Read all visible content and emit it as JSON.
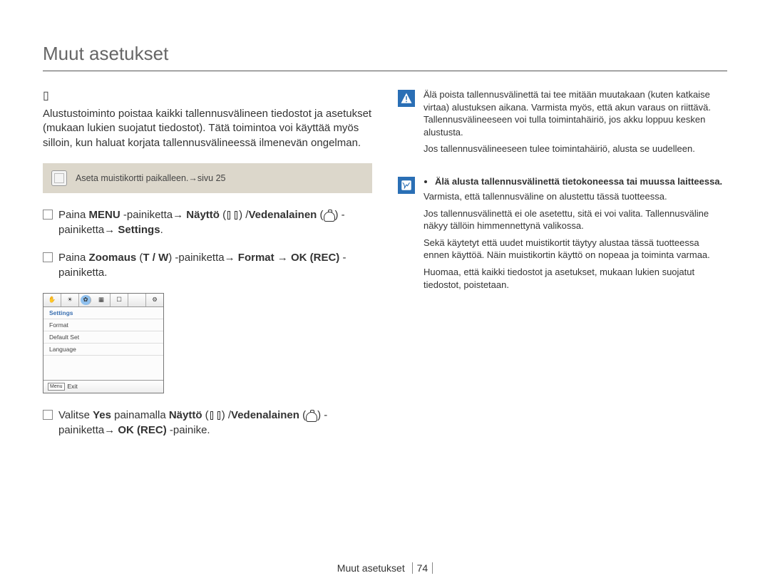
{
  "page": {
    "title": "Muut asetukset",
    "footer_section": "Muut asetukset",
    "page_number": "74"
  },
  "left": {
    "subheading_placeholder": "▯",
    "intro": "Alustustoiminto poistaa kaikki tallennusvälineen tiedostot ja asetukset (mukaan lukien suojatut tiedostot). Tätä toimintoa voi käyttää myös silloin, kun haluat korjata tallennusvälineessä ilmenevän ongelman.",
    "note": "Aseta muistikortti paikalleen.→sivu 25",
    "steps": [
      {
        "t1": "Paina ",
        "b1": "MENU",
        "t2": " -painiketta→ ",
        "b2": "Näyttö",
        "t3": " /",
        "b3": "Vedenalainen",
        "t4": " -painiketta→ ",
        "b4": "Settings",
        "t5": "."
      },
      {
        "t1": "Paina ",
        "b1": "Zoomaus",
        "t2": " (",
        "b2": "T / W",
        "t3": ") -painiketta→",
        "b3": "Format",
        "t4": " → ",
        "b4": "OK (REC)",
        "t5": " -painiketta."
      },
      {
        "t1": "Valitse ",
        "b1": "Yes",
        "t2": " painamalla ",
        "b2": "Näyttö",
        "t3": " /",
        "b3": "Vedenalainen",
        "t4": " -painiketta→ ",
        "b4": "OK (REC)",
        "t5": " -painike."
      }
    ],
    "screenshot": {
      "tab_hand": "✋",
      "title": "Settings",
      "rows": [
        "Format",
        "Default Set",
        "Language"
      ],
      "menu_btn": "Menu",
      "exit": "Exit"
    }
  },
  "right": {
    "warning": {
      "p1": "Älä poista tallennusvälinettä tai tee mitään muutakaan (kuten katkaise virtaa) alustuksen aikana. Varmista myös, että akun varaus on riittävä. Tallennusvälineeseen voi tulla toimintahäiriö, jos akku loppuu kesken alustusta.",
      "p2": "Jos tallennusvälineeseen tulee toimintahäiriö, alusta se uudelleen."
    },
    "info": {
      "bullet_b": "Älä alusta tallennusvälinettä tietokoneessa tai muussa laitteessa.",
      "p1": "Varmista, että tallennusväline on alustettu tässä tuotteessa.",
      "p2": "Jos tallennusvälinettä ei ole asetettu, sitä ei voi valita. Tallennusväline näkyy tällöin himmennettynä valikossa.",
      "p3": "Sekä käytetyt että uudet muistikortit täytyy alustaa tässä tuotteessa ennen käyttöä. Näin muistikortin käyttö on nopeaa ja toiminta varmaa.",
      "p4": "Huomaa, että kaikki tiedostot ja asetukset, mukaan lukien suojatut tiedostot, poistetaan."
    }
  }
}
